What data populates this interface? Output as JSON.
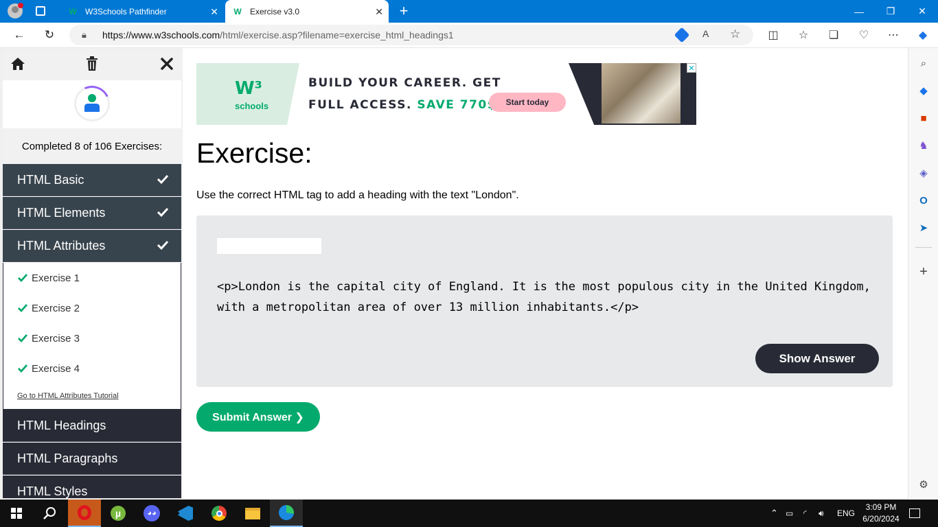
{
  "browser": {
    "tabs": [
      {
        "label": "W3Schools Pathfinder",
        "favicon": "w3schools-icon"
      },
      {
        "label": "Exercise v3.0",
        "favicon": "w3schools-icon",
        "active": true
      }
    ],
    "url_domain": "https://www.w3schools.com",
    "url_path": "/html/exercise.asp?filename=exercise_html_headings1",
    "accent_color": "#0078d4"
  },
  "pathfinder": {
    "completed_text": "Completed 8 of 106 Exercises:",
    "categories_top": [
      {
        "label": "HTML Basic",
        "done": true
      },
      {
        "label": "HTML Elements",
        "done": true
      },
      {
        "label": "HTML Attributes",
        "done": true
      }
    ],
    "exercises": [
      {
        "label": "Exercise 1",
        "done": true
      },
      {
        "label": "Exercise 2",
        "done": true
      },
      {
        "label": "Exercise 3",
        "done": true
      },
      {
        "label": "Exercise 4",
        "done": true
      }
    ],
    "tutorial_link": "Go to HTML Attributes Tutorial",
    "categories_bottom": [
      {
        "label": "HTML Headings"
      },
      {
        "label": "HTML Paragraphs"
      },
      {
        "label": "HTML Styles"
      }
    ]
  },
  "ad": {
    "logo_text": "W³",
    "logo_sub": "schools",
    "line1": "BUILD YOUR CAREER. GET",
    "line2_a": "FULL ACCESS.",
    "line2_b": "SAVE 770$",
    "button": "Start today",
    "close": "✕"
  },
  "exercise": {
    "title": "Exercise:",
    "instruction": "Use the correct HTML tag to add a heading with the text \"London\".",
    "answer_value": "",
    "code_line1": "<p>London is the capital city of England. It is the most populous city in the United Kingdom,",
    "code_line2": "with a metropolitan area of over 13 million inhabitants.</p>",
    "show_answer": "Show Answer",
    "submit": "Submit Answer ❯"
  },
  "taskbar": {
    "lang": "ENG",
    "time": "3:09 PM",
    "date": "6/20/2024"
  },
  "colors": {
    "green": "#04aa6d",
    "dark": "#282a35",
    "pink": "#ffb7c4"
  }
}
